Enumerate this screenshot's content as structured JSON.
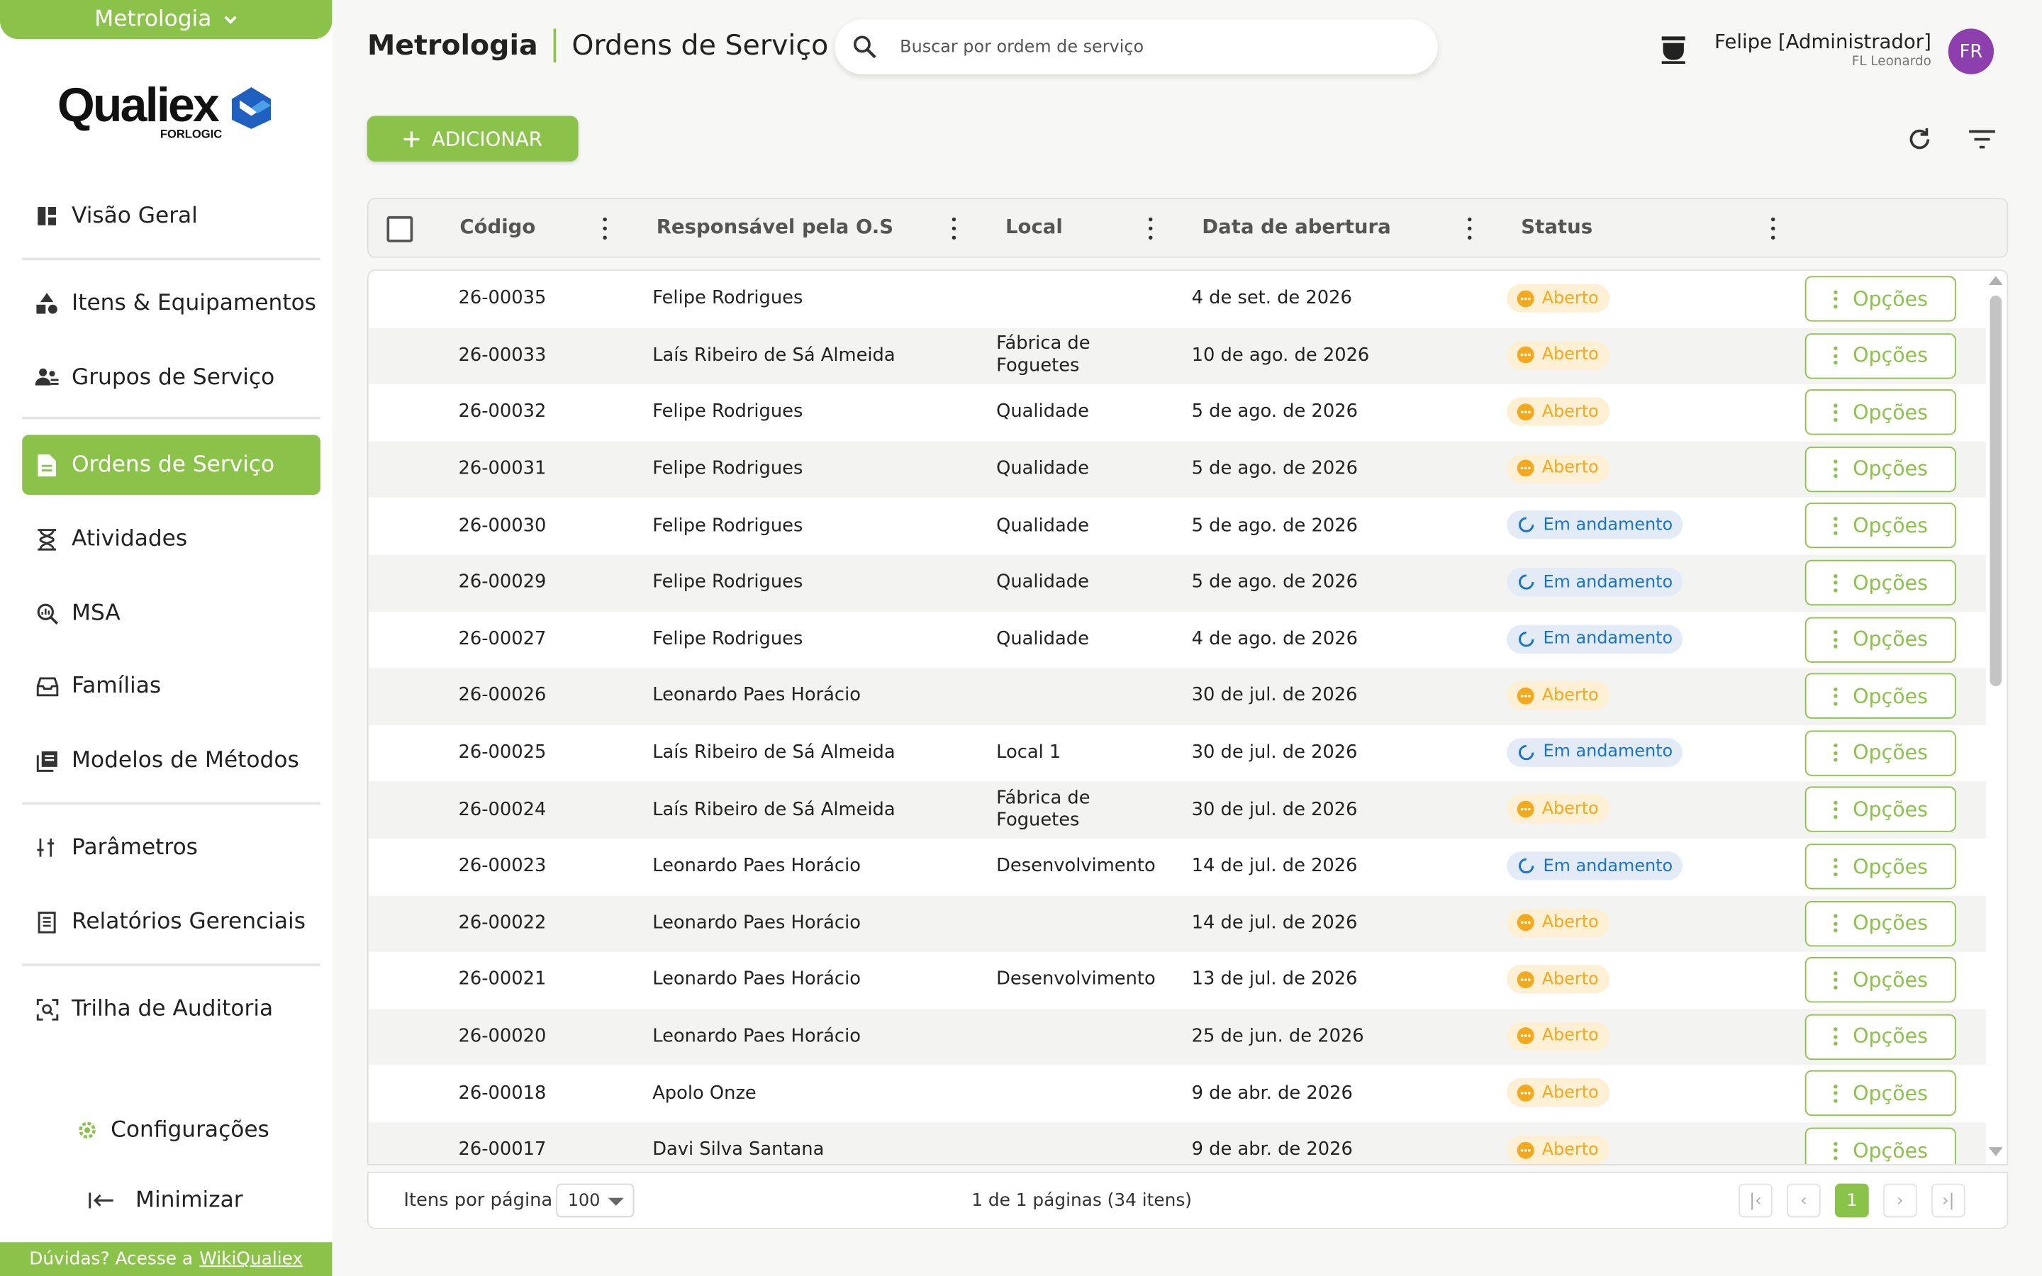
{
  "module_selector": "Metrologia",
  "logo": {
    "word": "Qualiex",
    "sub": "FORLOGIC"
  },
  "sidebar": {
    "items": [
      {
        "label": "Visão Geral",
        "icon": "dashboard-icon"
      },
      {
        "label": "Itens & Equipamentos",
        "icon": "shapes-icon"
      },
      {
        "label": "Grupos de Serviço",
        "icon": "group-icon"
      },
      {
        "label": "Ordens de Serviço",
        "icon": "document-icon",
        "active": true
      },
      {
        "label": "Atividades",
        "icon": "hourglass-icon"
      },
      {
        "label": "MSA",
        "icon": "analysis-icon"
      },
      {
        "label": "Famílias",
        "icon": "tray-icon"
      },
      {
        "label": "Modelos de Métodos",
        "icon": "library-icon"
      },
      {
        "label": "Parâmetros",
        "icon": "sliders-icon"
      },
      {
        "label": "Relatórios Gerenciais",
        "icon": "report-icon"
      },
      {
        "label": "Trilha de Auditoria",
        "icon": "audit-icon"
      }
    ],
    "settings": "Configurações",
    "minimize": "Minimizar",
    "help_text": "Dúvidas? Acesse a",
    "help_link": "WikiQualiex"
  },
  "header": {
    "module": "Metrologia",
    "page": "Ordens de Serviço",
    "search_placeholder": "Buscar por ordem de serviço",
    "user_name": "Felipe [Administrador]",
    "user_company": "FL Leonardo",
    "avatar_initials": "FR"
  },
  "toolbar": {
    "add_label": "ADICIONAR"
  },
  "table": {
    "columns": {
      "code": "Código",
      "responsible": "Responsável pela O.S",
      "location": "Local",
      "opened": "Data de abertura",
      "status": "Status"
    },
    "options_label": "Opções",
    "rows": [
      {
        "code": "26-00035",
        "responsible": "Felipe Rodrigues",
        "location": "",
        "opened": "4 de set. de 2026",
        "status": "Aberto"
      },
      {
        "code": "26-00033",
        "responsible": "Laís Ribeiro de Sá Almeida",
        "location": "Fábrica de Foguetes",
        "opened": "10 de ago. de 2026",
        "status": "Aberto"
      },
      {
        "code": "26-00032",
        "responsible": "Felipe Rodrigues",
        "location": "Qualidade",
        "opened": "5 de ago. de 2026",
        "status": "Aberto"
      },
      {
        "code": "26-00031",
        "responsible": "Felipe Rodrigues",
        "location": "Qualidade",
        "opened": "5 de ago. de 2026",
        "status": "Aberto"
      },
      {
        "code": "26-00030",
        "responsible": "Felipe Rodrigues",
        "location": "Qualidade",
        "opened": "5 de ago. de 2026",
        "status": "Em andamento"
      },
      {
        "code": "26-00029",
        "responsible": "Felipe Rodrigues",
        "location": "Qualidade",
        "opened": "5 de ago. de 2026",
        "status": "Em andamento"
      },
      {
        "code": "26-00027",
        "responsible": "Felipe Rodrigues",
        "location": "Qualidade",
        "opened": "4 de ago. de 2026",
        "status": "Em andamento"
      },
      {
        "code": "26-00026",
        "responsible": "Leonardo Paes Horácio",
        "location": "",
        "opened": "30 de jul. de 2026",
        "status": "Aberto"
      },
      {
        "code": "26-00025",
        "responsible": "Laís Ribeiro de Sá Almeida",
        "location": "Local 1",
        "opened": "30 de jul. de 2026",
        "status": "Em andamento"
      },
      {
        "code": "26-00024",
        "responsible": "Laís Ribeiro de Sá Almeida",
        "location": "Fábrica de Foguetes",
        "opened": "30 de jul. de 2026",
        "status": "Aberto"
      },
      {
        "code": "26-00023",
        "responsible": "Leonardo Paes Horácio",
        "location": "Desenvolvimento",
        "opened": "14 de jul. de 2026",
        "status": "Em andamento"
      },
      {
        "code": "26-00022",
        "responsible": "Leonardo Paes Horácio",
        "location": "",
        "opened": "14 de jul. de 2026",
        "status": "Aberto"
      },
      {
        "code": "26-00021",
        "responsible": "Leonardo Paes Horácio",
        "location": "Desenvolvimento",
        "opened": "13 de jul. de 2026",
        "status": "Aberto"
      },
      {
        "code": "26-00020",
        "responsible": "Leonardo Paes Horácio",
        "location": "",
        "opened": "25 de jun. de 2026",
        "status": "Aberto"
      },
      {
        "code": "26-00018",
        "responsible": "Apolo Onze",
        "location": "",
        "opened": "9 de abr. de 2026",
        "status": "Aberto"
      },
      {
        "code": "26-00017",
        "responsible": "Davi Silva Santana",
        "location": "",
        "opened": "9 de abr. de 2026",
        "status": "Aberto"
      }
    ]
  },
  "pagination": {
    "items_per_page_label": "Itens por página",
    "items_per_page": "100",
    "info": "1 de 1 páginas (34 itens)",
    "current_page": "1"
  },
  "colors": {
    "accent": "#8bc34a",
    "open": "#f3a81d",
    "in_progress": "#1a73c7",
    "avatar": "#8e3fae"
  }
}
